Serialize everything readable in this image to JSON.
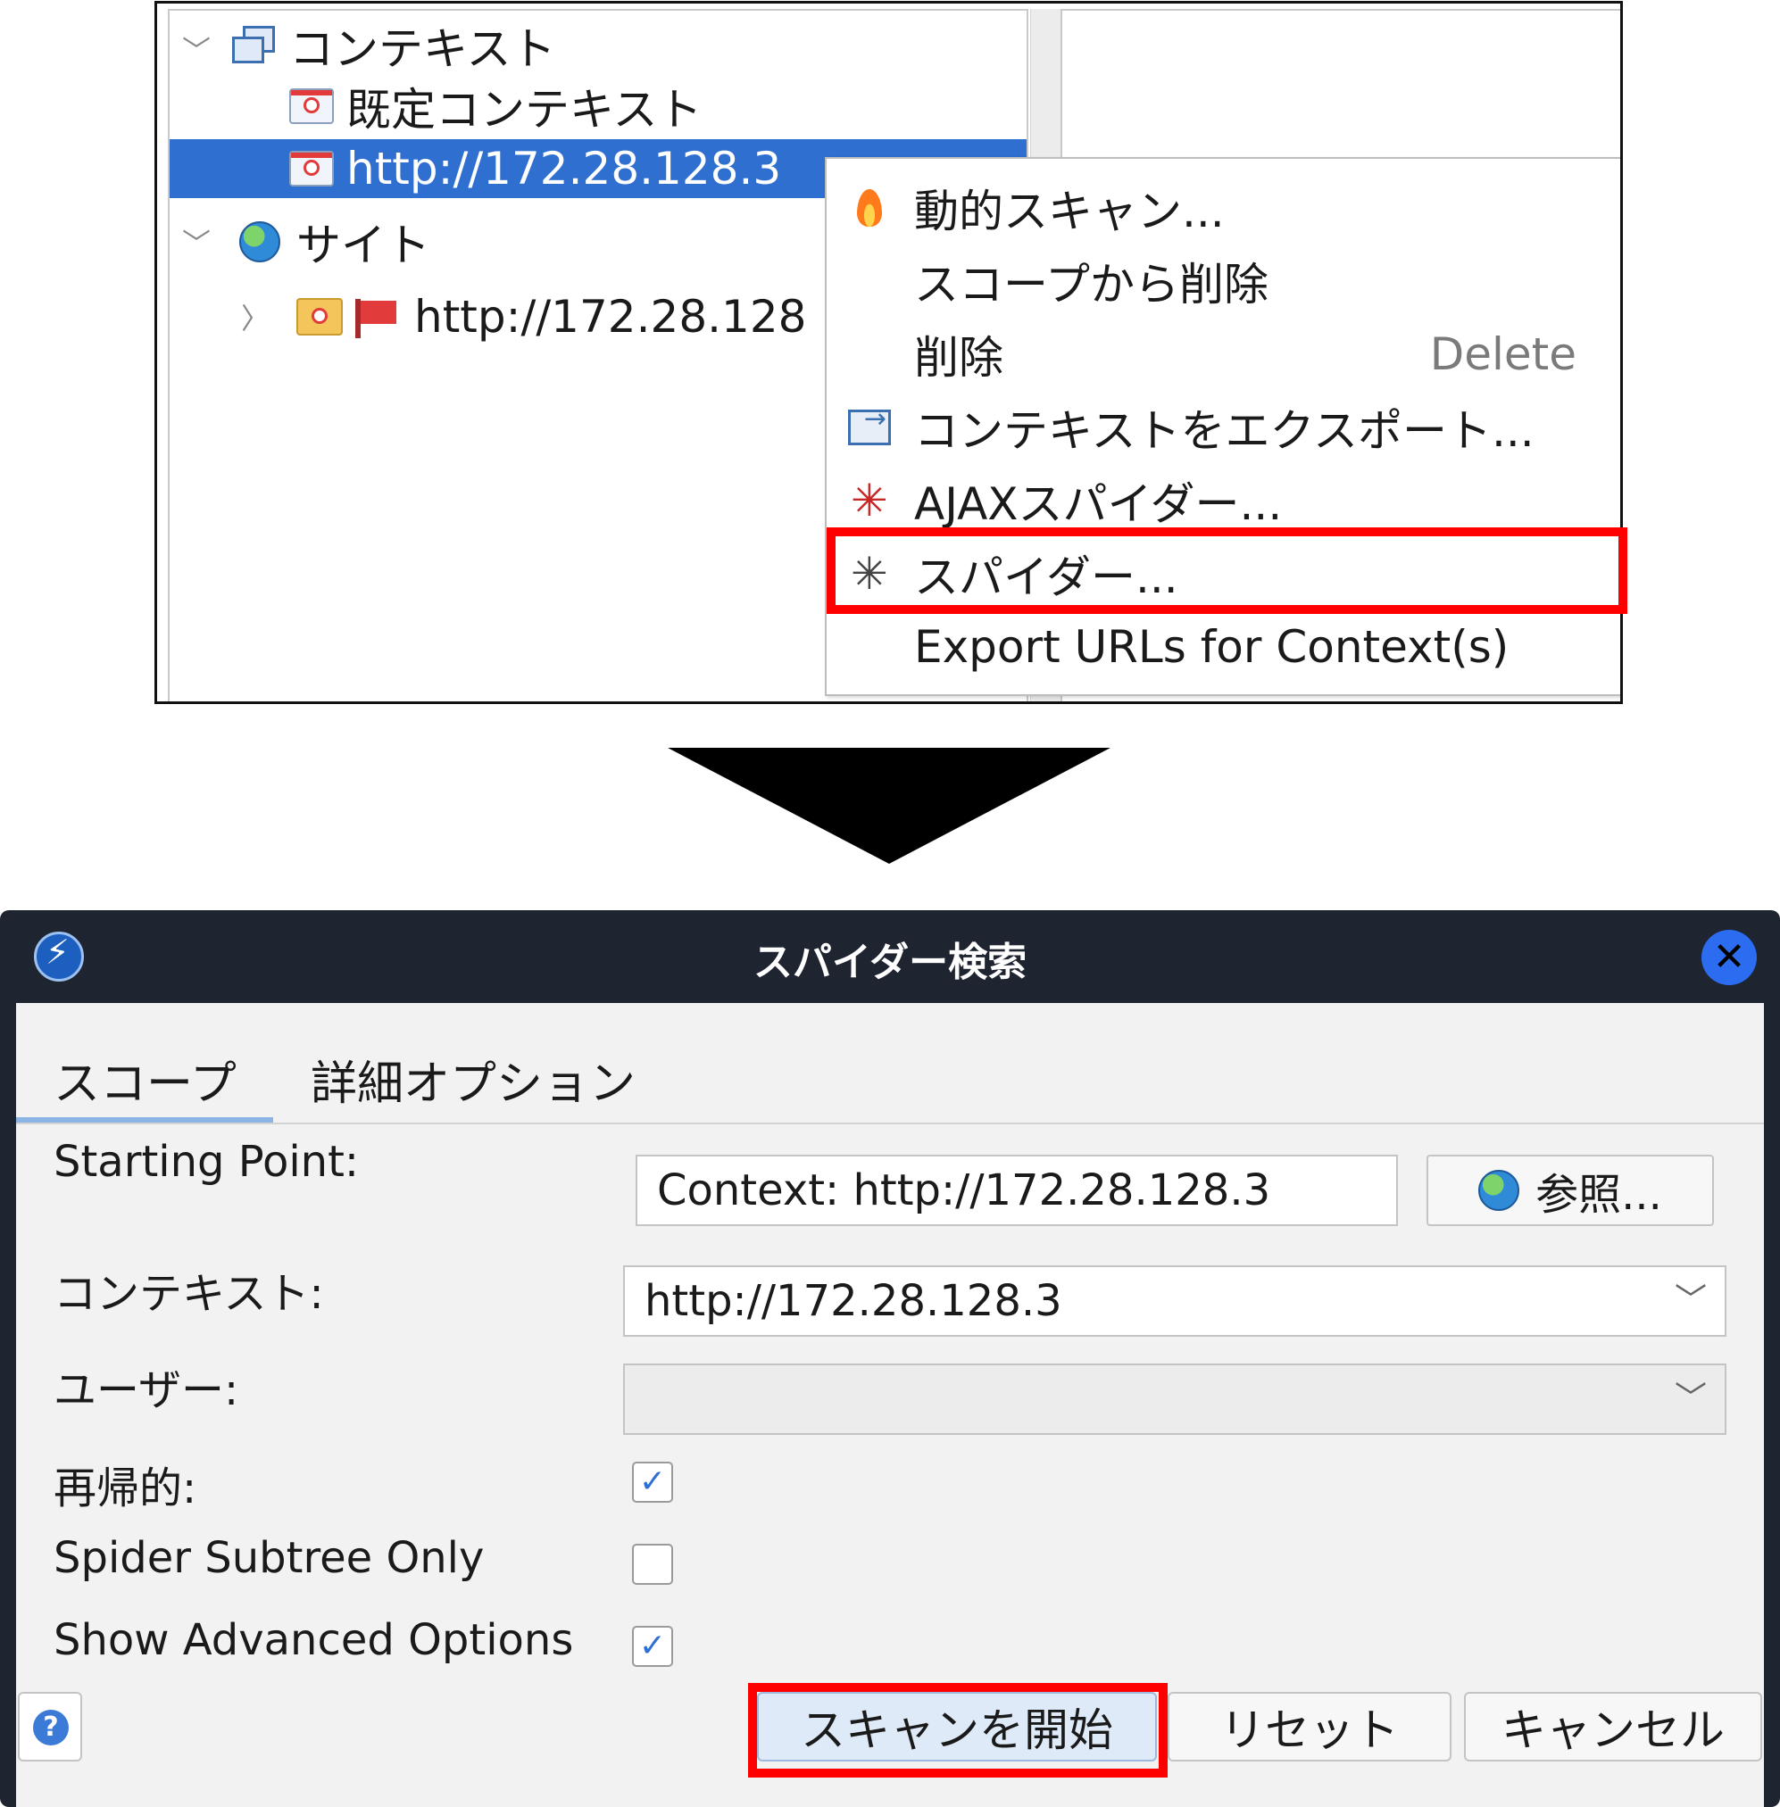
{
  "tree": {
    "contexts_label": "コンテキスト",
    "default_context": "既定コンテキスト",
    "selected_context": "http://172.28.128.3",
    "sites_label": "サイト",
    "site_node": "http://172.28.128"
  },
  "context_menu": {
    "items": [
      {
        "label": "動的スキャン...",
        "icon": "flame-icon",
        "shortcut": ""
      },
      {
        "label": "スコープから削除",
        "icon": "",
        "shortcut": ""
      },
      {
        "label": "削除",
        "icon": "",
        "shortcut": "Delete"
      },
      {
        "label": "コンテキストをエクスポート...",
        "icon": "export-icon",
        "shortcut": ""
      },
      {
        "label": "AJAXスパイダー...",
        "icon": "ajax-spider-icon",
        "shortcut": ""
      },
      {
        "label": "スパイダー...",
        "icon": "spider-icon",
        "shortcut": ""
      },
      {
        "label": "Export URLs for Context(s)",
        "icon": "",
        "shortcut": ""
      }
    ]
  },
  "dialog": {
    "title": "スパイダー検索",
    "close_symbol": "✕",
    "tabs": [
      "スコープ",
      "詳細オプション"
    ],
    "starting_point_label": "Starting Point:",
    "starting_point_value": "Context: http://172.28.128.3",
    "browse_label": "参照...",
    "context_label": "コンテキスト:",
    "context_value": "http://172.28.128.3",
    "user_label": "ユーザー:",
    "user_value": "",
    "recursive_label": "再帰的:",
    "recursive_checked": true,
    "subtree_label": "Spider Subtree Only",
    "subtree_checked": false,
    "advanced_label": "Show Advanced Options",
    "advanced_checked": true,
    "help_symbol": "?",
    "buttons": {
      "start": "スキャンを開始",
      "reset": "リセット",
      "cancel": "キャンセル"
    }
  },
  "colors": {
    "highlight": "#ff0000",
    "selection": "#2f6fd0",
    "titlebar": "#1e2430"
  }
}
